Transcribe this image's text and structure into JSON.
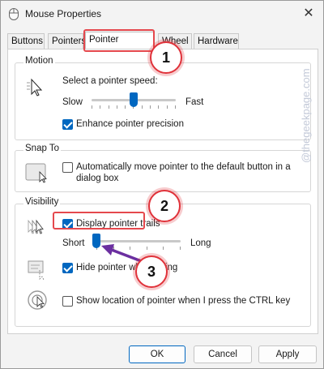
{
  "window": {
    "title": "Mouse Properties",
    "close_glyph": "✕"
  },
  "tabs": [
    {
      "label": "Buttons"
    },
    {
      "label": "Pointers"
    },
    {
      "label": "Pointer Options"
    },
    {
      "label": "Wheel"
    },
    {
      "label": "Hardware"
    }
  ],
  "motion": {
    "title": "Motion",
    "speed_label": "Select a pointer speed:",
    "slow_label": "Slow",
    "fast_label": "Fast",
    "speed_value": 0.5,
    "enhance_label": "Enhance pointer precision",
    "enhance_checked": true
  },
  "snap": {
    "title": "Snap To",
    "label_line1": "Automatically move pointer to the default button in a",
    "label_line2": "dialog box",
    "checked": false
  },
  "visibility": {
    "title": "Visibility",
    "trails_label": "Display pointer trails",
    "trails_checked": true,
    "short_label": "Short",
    "long_label": "Long",
    "trail_value": 0.0,
    "hide_label": "Hide pointer while typing",
    "hide_checked": true,
    "show_label": "Show location of pointer when I press the CTRL key",
    "show_checked": false
  },
  "buttons": {
    "ok": "OK",
    "cancel": "Cancel",
    "apply": "Apply"
  },
  "annotations": {
    "badge1": "1",
    "badge2": "2",
    "badge3": "3",
    "accent": "#e5484d",
    "arrow_color": "#6b2fa0"
  },
  "watermark": "@thegeekpage.com"
}
